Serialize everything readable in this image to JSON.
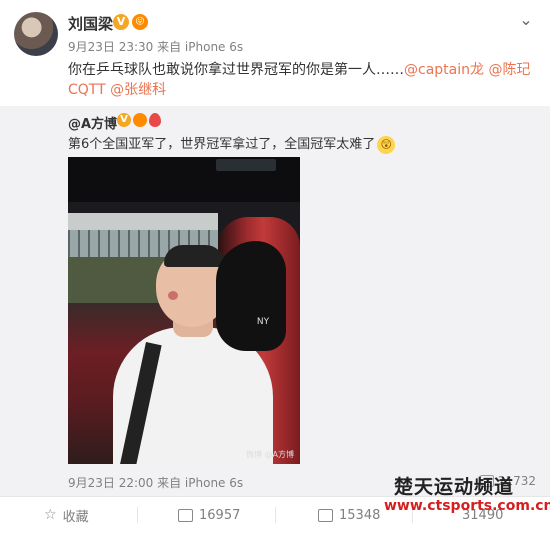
{
  "post": {
    "author": "刘国梁",
    "verified": "V",
    "vip": "😜",
    "meta": "9月23日 23:30 来自 iPhone 6s",
    "text": "你在乒乓球队也敢说你拿过世界冠军的你是第一人……",
    "mentions": [
      "@captain龙",
      "@陈玘CQTT",
      "@张继科"
    ]
  },
  "repost": {
    "author": "@A方博",
    "verified": "V",
    "text": "第6个全国亚军了，世界冠军拿过了，全国冠军太难了",
    "emoji": "😲",
    "photo_watermark": "微博 @A方博",
    "photo_cap_logo": "NY",
    "meta": "9月23日 22:00 来自 iPhone 6s",
    "repost_count": "21732"
  },
  "footer": {
    "favorite_label": "收藏",
    "repost_count": "16957",
    "comment_count": "15348",
    "like_count": "31490"
  },
  "watermark": {
    "line1": "楚天运动频道",
    "line2": "www.ctsports.com.cn"
  },
  "icons": {
    "chevron": "chevron-down-icon",
    "favorite": "star-icon",
    "repost": "repost-icon",
    "comment": "comment-icon",
    "like": "like-icon"
  }
}
